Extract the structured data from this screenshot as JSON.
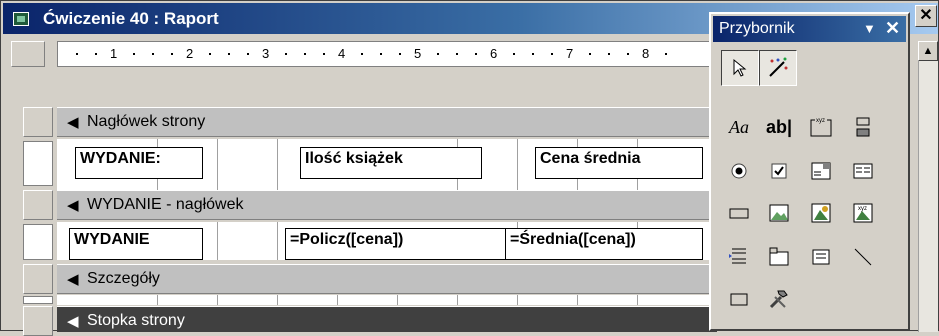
{
  "window": {
    "title": "Ćwiczenie 40 : Raport"
  },
  "ruler": {
    "numbers": [
      "1",
      "2",
      "3",
      "4",
      "5",
      "6",
      "7",
      "8"
    ]
  },
  "sections": {
    "page_header": "Nagłówek strony",
    "group_header": "WYDANIE - nagłówek",
    "detail": "Szczegóły",
    "page_footer": "Stopka strony"
  },
  "page_header_controls": {
    "wydanie_label": "WYDANIE:",
    "ilosc_label": "Ilość książek",
    "cena_label": "Cena średnia"
  },
  "group_header_controls": {
    "wydanie_field": "WYDANIE",
    "policz_field": "=Policz([cena])",
    "srednia_field": "=Średnia([cena])"
  },
  "toolbox": {
    "title": "Przybornik",
    "menu_glyph": "▼",
    "close_glyph": "✕",
    "tools": [
      "select-objects",
      "control-wizards",
      "label",
      "text-box",
      "option-group",
      "toggle-button",
      "option-button",
      "check-box",
      "combo-box",
      "list-box",
      "command-button",
      "image",
      "unbound-object-frame",
      "bound-object-frame",
      "page-break",
      "tab-control",
      "subform-subreport",
      "line",
      "rectangle",
      "more-controls"
    ],
    "label_glyph": "Aa",
    "textbox_glyph": "ab|"
  },
  "colors": {
    "titlebar_start": "#0a246a",
    "titlebar_end": "#a6caf0",
    "section_bar": "#c0c0c0",
    "footer_bar": "#404040"
  }
}
